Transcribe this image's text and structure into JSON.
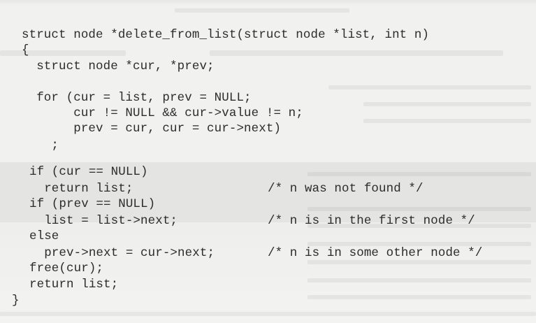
{
  "code_lines": [
    "struct node *delete_from_list(struct node *list, int n)",
    "{",
    "  struct node *cur, *prev;",
    "  for (cur = list, prev = NULL;",
    "       cur != NULL && cur->value != n;",
    "       prev = cur, cur = cur->next)",
    "    ;",
    "if (cur == NULL)",
    "  return list;",
    "/* n was not found */",
    "if (prev == NULL)",
    "  list = list->next;",
    "/* n is in the first node */",
    "else",
    "  prev->next = cur->next;",
    "/* n is in some other node */",
    "free(cur);",
    "return list;",
    "}"
  ]
}
